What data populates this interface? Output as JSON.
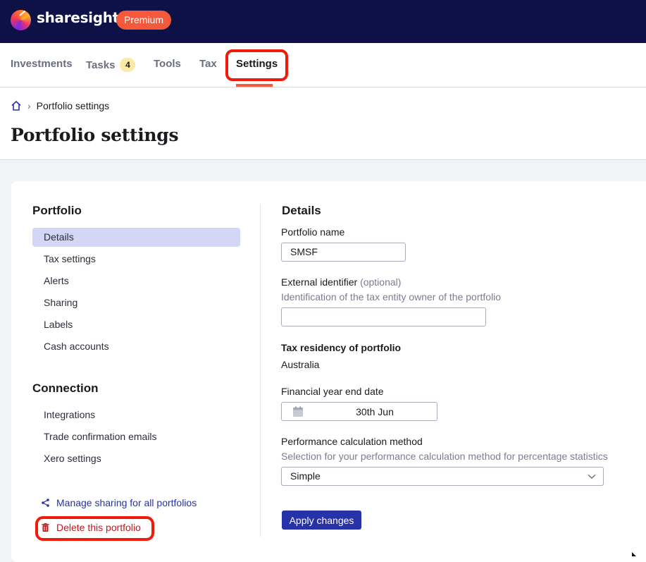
{
  "brand": {
    "name": "sharesight",
    "plan": "Premium"
  },
  "nav": {
    "items": [
      {
        "label": "Investments"
      },
      {
        "label": "Tasks",
        "badge": "4"
      },
      {
        "label": "Tools"
      },
      {
        "label": "Tax"
      },
      {
        "label": "Settings",
        "active": true
      }
    ]
  },
  "breadcrumb": {
    "current": "Portfolio settings"
  },
  "page": {
    "title": "Portfolio settings"
  },
  "sidebar": {
    "portfolio_heading": "Portfolio",
    "portfolio_items": [
      "Details",
      "Tax settings",
      "Alerts",
      "Sharing",
      "Labels",
      "Cash accounts"
    ],
    "connection_heading": "Connection",
    "connection_items": [
      "Integrations",
      "Trade confirmation emails",
      "Xero settings"
    ],
    "manage_sharing_link": "Manage sharing for all portfolios",
    "delete_link": "Delete this portfolio"
  },
  "details": {
    "heading": "Details",
    "portfolio_name_label": "Portfolio name",
    "portfolio_name_value": "SMSF",
    "external_id_label": "External identifier",
    "external_id_optional": "(optional)",
    "external_id_help": "Identification of the tax entity owner of the portfolio",
    "external_id_value": "",
    "tax_residency_label": "Tax residency of portfolio",
    "tax_residency_value": "Australia",
    "fy_end_label": "Financial year end date",
    "fy_end_value": "30th Jun",
    "perf_method_label": "Performance calculation method",
    "perf_method_help": "Selection for your performance calculation method for percentage statistics",
    "perf_method_value": "Simple",
    "apply_button": "Apply changes"
  },
  "colors": {
    "navy": "#0e1145",
    "accent": "#f3593a",
    "primary_button": "#2732a8",
    "highlight": "#f01c0b"
  }
}
